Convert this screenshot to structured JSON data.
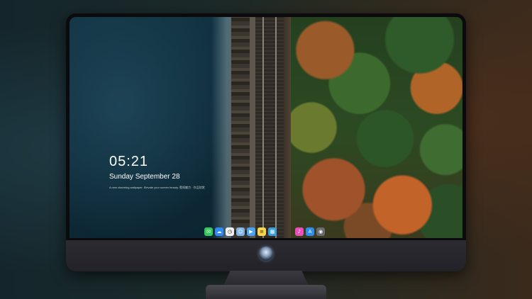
{
  "lock_screen": {
    "time": "05:21",
    "date": "Sunday September  28",
    "hint": "A new charming wallpaper. Elevate your screen beauty. 壁纸魅力 · 作品欣赏"
  },
  "dock": {
    "left_apps": [
      {
        "name": "Messages",
        "glyph": "✉",
        "color": "#34c759"
      },
      {
        "name": "Weather",
        "glyph": "☁",
        "color": "#2f8bf5"
      },
      {
        "name": "Clock",
        "glyph": "◷",
        "color": "#f2f2f2"
      },
      {
        "name": "Finder",
        "glyph": "☺",
        "color": "#7fb4e8"
      },
      {
        "name": "Movies",
        "glyph": "▶",
        "color": "#4aa3f0"
      },
      {
        "name": "Notes",
        "glyph": "≡",
        "color": "#f7d64a"
      },
      {
        "name": "Photos",
        "glyph": "▦",
        "color": "#3aa0d8"
      }
    ],
    "right_apps": [
      {
        "name": "Music",
        "glyph": "♪",
        "color": "#e84fb8"
      },
      {
        "name": "App Store",
        "glyph": "A",
        "color": "#2d8ef0"
      },
      {
        "name": "Camera",
        "glyph": "◉",
        "color": "#6a6a70"
      }
    ]
  },
  "colors": {
    "sea": "#0f2c3a",
    "bezel": "#0b0b0d",
    "chin": "#2c2b32",
    "text": "#ffffff"
  }
}
